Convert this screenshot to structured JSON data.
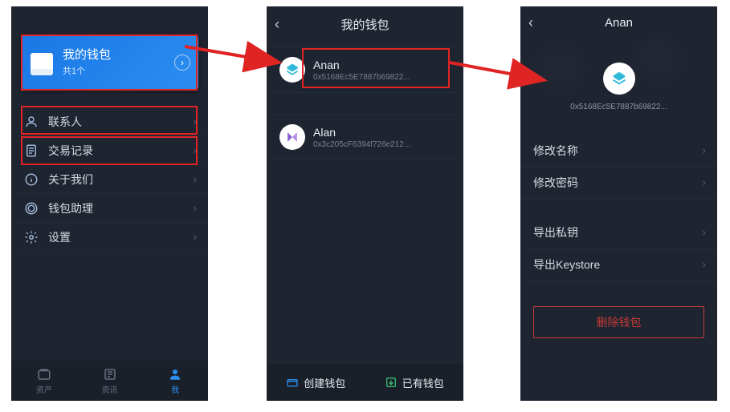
{
  "screen1": {
    "wallet_card": {
      "title": "我的钱包",
      "sub": "共1个"
    },
    "menu": [
      {
        "icon": "person",
        "label": "联系人"
      },
      {
        "icon": "doc",
        "label": "交易记录"
      },
      {
        "icon": "info",
        "label": "关于我们"
      },
      {
        "icon": "wallet",
        "label": "钱包助理"
      },
      {
        "icon": "gear",
        "label": "设置"
      }
    ],
    "tabs": [
      {
        "label": "资产",
        "active": false
      },
      {
        "label": "资讯",
        "active": false
      },
      {
        "label": "我",
        "active": true
      }
    ]
  },
  "screen2": {
    "header_title": "我的钱包",
    "wallets": [
      {
        "name": "Anan",
        "address": "0x5168Ec5E7887b69822...",
        "icon": "anan"
      },
      {
        "name": "Alan",
        "address": "0x3c205cF6394f726e212...",
        "icon": "alan"
      }
    ],
    "actions": {
      "create": "创建钱包",
      "import": "已有钱包"
    }
  },
  "screen3": {
    "header_title": "Anan",
    "address": "0x5168Ec5E7887b69822...",
    "items_a": [
      "修改名称",
      "修改密码"
    ],
    "items_b": [
      "导出私钥",
      "导出Keystore"
    ],
    "delete_label": "删除钱包"
  },
  "colors": {
    "accent": "#2b8df0",
    "danger": "#c73a38",
    "highlight": "#e02424"
  }
}
